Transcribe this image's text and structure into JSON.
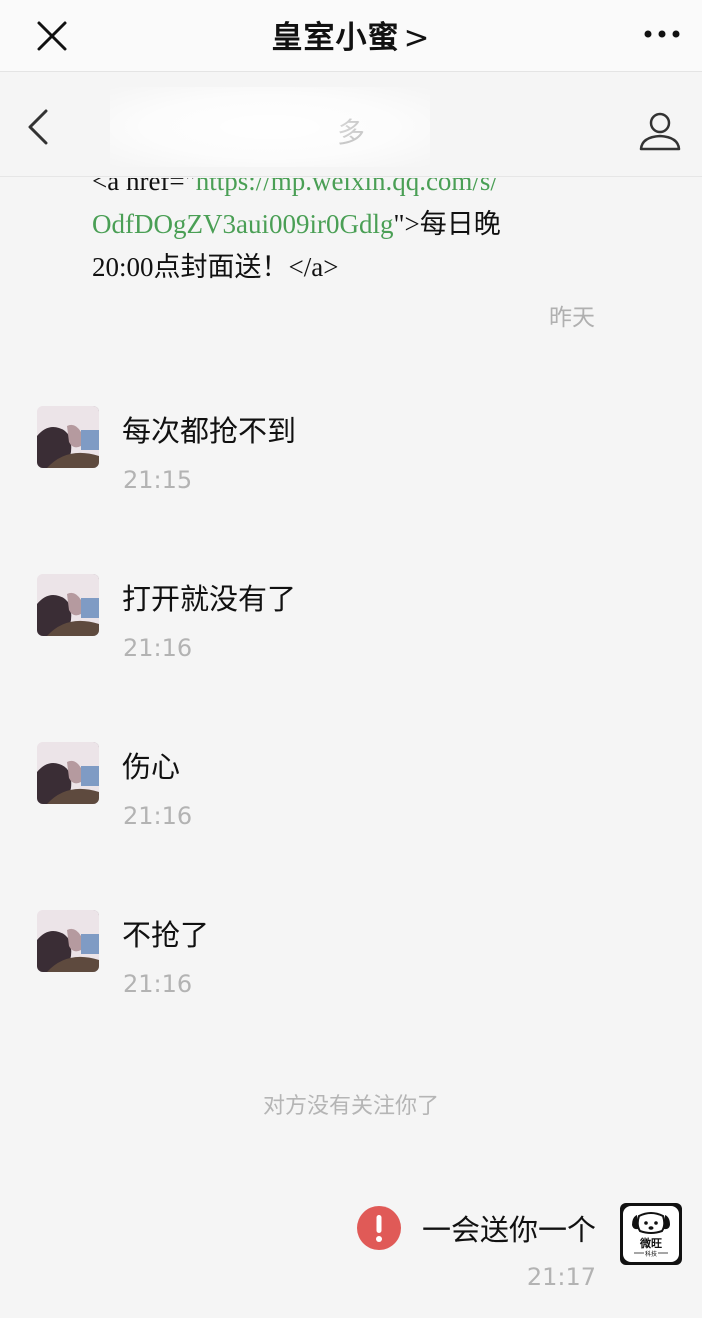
{
  "top_bar": {
    "title": "皇室小蜜",
    "chevron": ">"
  },
  "nav_bar": {
    "title": "多"
  },
  "cut_message": {
    "line1_prefix": "<a href=\"",
    "line1_link": "https://mp.weixin.qq.com/s/",
    "line2_link": "OdfDOgZV3aui009ir0Gdlg",
    "line2_suffix": "\">每日晚",
    "line3": "20:00点封面送！</a>",
    "time": "昨天"
  },
  "messages": [
    {
      "text": "每次都抢不到",
      "time": "21:15"
    },
    {
      "text": "打开就没有了",
      "time": "21:16"
    },
    {
      "text": "伤心",
      "time": "21:16"
    },
    {
      "text": "不抢了",
      "time": "21:16"
    }
  ],
  "system_note": "对方没有关注你了",
  "my_message": {
    "text": "一会送你一个",
    "time": "21:17",
    "avatar_text": "微旺",
    "avatar_subtext": "科技"
  },
  "colors": {
    "link": "#4a9f55",
    "error": "#e05a57",
    "time": "#b3b3b3"
  }
}
